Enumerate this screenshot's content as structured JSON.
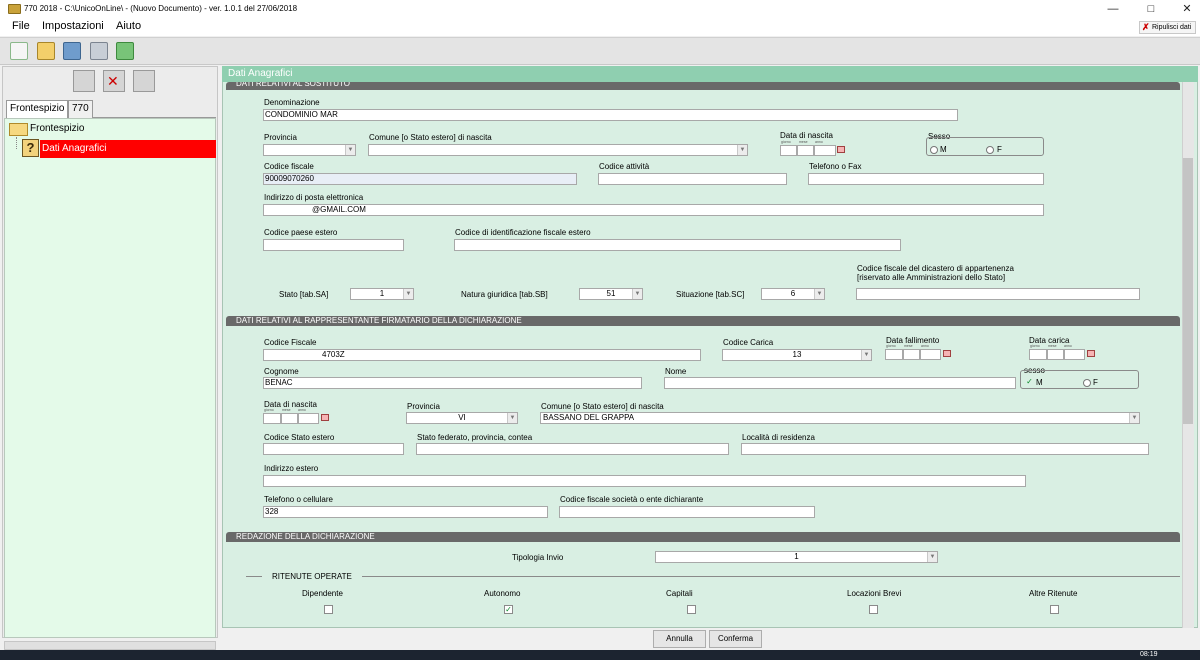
{
  "window": {
    "title": "770 2018 - C:\\UnicoOnLine\\ - (Nuovo Documento)  -  ver. 1.0.1 del 27/06/2018"
  },
  "menu": {
    "file": "File",
    "impostazioni": "Impostazioni",
    "aiuto": "Aiuto",
    "ripulisci": "Ripulisci dati"
  },
  "left": {
    "tabs": [
      "Frontespizio",
      "770"
    ],
    "tree": {
      "root": "Frontespizio",
      "selected": "Dati Anagrafici"
    }
  },
  "main": {
    "header": "Dati Anagrafici",
    "sections": {
      "sostituto": "DATI RELATIVI AL SOSTITUTO",
      "rappresentante": "DATI RELATIVI AL RAPPRESENTANTE FIRMATARIO DELLA DICHIARAZIONE",
      "redazione": "REDAZIONE DELLA DICHIARAZIONE"
    },
    "sostituto": {
      "denominazione_label": "Denominazione",
      "denominazione": "CONDOMINIO MAR",
      "provincia_label": "Provincia",
      "provincia": "",
      "comune_label": "Comune [o Stato estero] di nascita",
      "comune": "",
      "data_nascita_label": "Data di nascita",
      "date_caps": [
        "giorno",
        "mese",
        "anno"
      ],
      "sesso_label": "Sesso",
      "sesso_m": "M",
      "sesso_f": "F",
      "codice_fiscale_label": "Codice fiscale",
      "codice_fiscale": "90009070260",
      "codice_attivita_label": "Codice attività",
      "codice_attivita": "",
      "telefono_label": "Telefono o Fax",
      "telefono": "",
      "email_label": "Indirizzo di posta elettronica",
      "email": "@GMAIL.COM",
      "codice_paese_label": "Codice paese estero",
      "codice_paese": "",
      "codice_id_estero_label": "Codice di identificazione fiscale estero",
      "codice_id_estero": "",
      "dicastero_label1": "Codice fiscale del dicastero di appartenenza",
      "dicastero_label2": "[riservato alle Amministrazioni dello Stato]",
      "dicastero": "",
      "stato_label": "Stato [tab.SA]",
      "stato": "1",
      "natura_label": "Natura giuridica [tab.SB]",
      "natura": "51",
      "situazione_label": "Situazione [tab.SC]",
      "situazione": "6"
    },
    "rappresentante": {
      "codice_fiscale_label": "Codice Fiscale",
      "codice_fiscale": "4703Z",
      "codice_carica_label": "Codice Carica",
      "codice_carica": "13",
      "data_fallimento_label": "Data fallimento",
      "data_carica_label": "Data carica",
      "cognome_label": "Cognome",
      "cognome": "BENAC",
      "nome_label": "Nome",
      "nome": "",
      "sesso_label": "sesso",
      "sesso_m": "M",
      "sesso_f": "F",
      "data_nascita_label": "Data di nascita",
      "provincia_label": "Provincia",
      "provincia": "VI",
      "comune_label": "Comune [o Stato estero] di nascita",
      "comune": "BASSANO DEL GRAPPA",
      "codice_stato_label": "Codice Stato estero",
      "codice_stato": "",
      "stato_federato_label": "Stato federato, provincia, contea",
      "stato_federato": "",
      "localita_label": "Località di residenza",
      "localita": "",
      "indirizzo_label": "Indirizzo estero",
      "indirizzo": "",
      "telefono_label": "Telefono o cellulare",
      "telefono": "328",
      "cf_societa_label": "Codice fiscale società o ente dichiarante",
      "cf_societa": ""
    },
    "redazione": {
      "tipologia_label": "Tipologia Invio",
      "tipologia": "1",
      "ritenute_label": "RITENUTE OPERATE",
      "ritenute": [
        {
          "label": "Dipendente",
          "checked": false
        },
        {
          "label": "Autonomo",
          "checked": true
        },
        {
          "label": "Capitali",
          "checked": false
        },
        {
          "label": "Locazioni Brevi",
          "checked": false
        },
        {
          "label": "Altre Ritenute",
          "checked": false
        }
      ]
    },
    "buttons": {
      "annulla": "Annulla",
      "conferma": "Conferma"
    }
  },
  "taskbar": {
    "clock": "08:19"
  }
}
